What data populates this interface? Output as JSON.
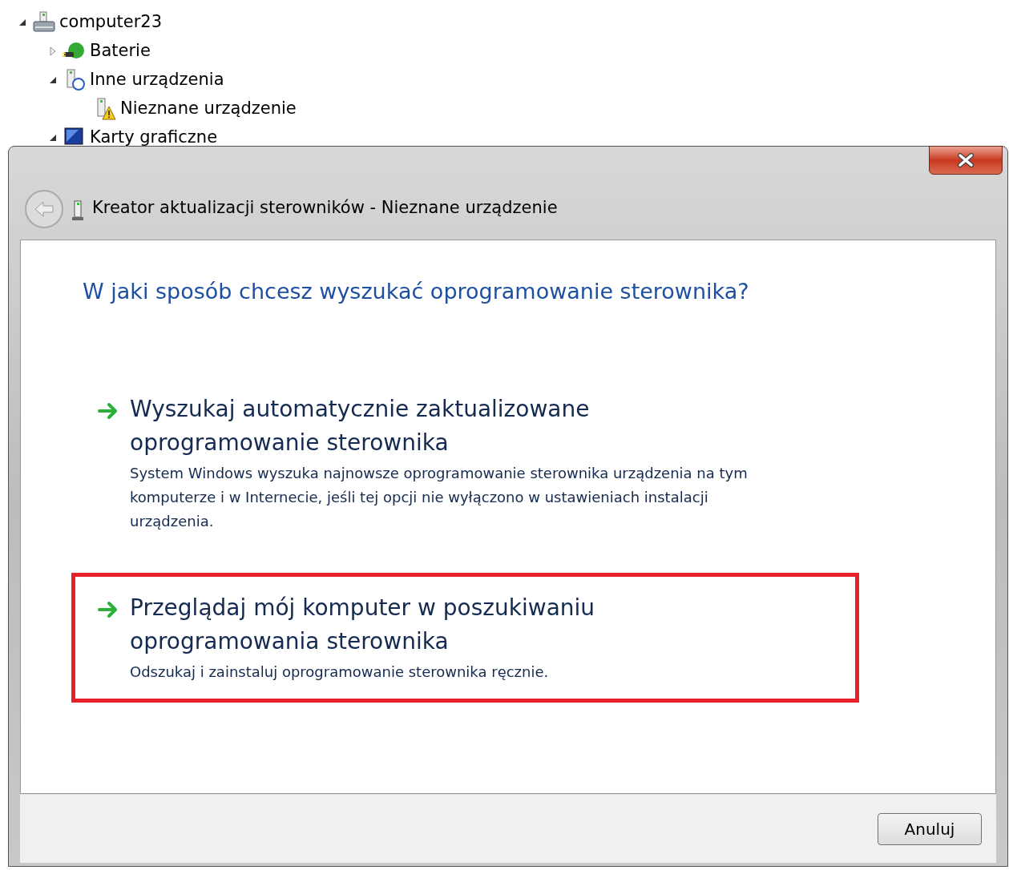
{
  "device_tree": [
    {
      "label": "computer23",
      "expanded": true,
      "kind": "computer",
      "children": [
        {
          "label": "Baterie",
          "expanded": false,
          "kind": "battery"
        },
        {
          "label": "Inne urządzenia",
          "expanded": true,
          "kind": "unknown",
          "children": [
            {
              "label": "Nieznane urządzenie",
              "kind": "warning"
            }
          ]
        },
        {
          "label": "Karty graficzne",
          "expanded": true,
          "kind": "display"
        }
      ]
    }
  ],
  "dialog": {
    "title": "Kreator aktualizacji sterowników - Nieznane urządzenie",
    "back_disabled": true,
    "heading": "W jaki sposób chcesz wyszukać oprogramowanie sterownika?",
    "options": [
      {
        "title": "Wyszukaj automatycznie zaktualizowane oprogramowanie sterownika",
        "description": "System Windows wyszuka najnowsze oprogramowanie sterownika urządzenia na tym komputerze i w Internecie, jeśli tej opcji nie wyłączono w ustawieniach instalacji urządzenia.",
        "highlighted": false
      },
      {
        "title": "Przeglądaj mój komputer w poszukiwaniu oprogramowania sterownika",
        "description": "Odszukaj i zainstaluj oprogramowanie sterownika ręcznie.",
        "highlighted": true
      }
    ],
    "buttons": [
      "Anuluj"
    ]
  }
}
